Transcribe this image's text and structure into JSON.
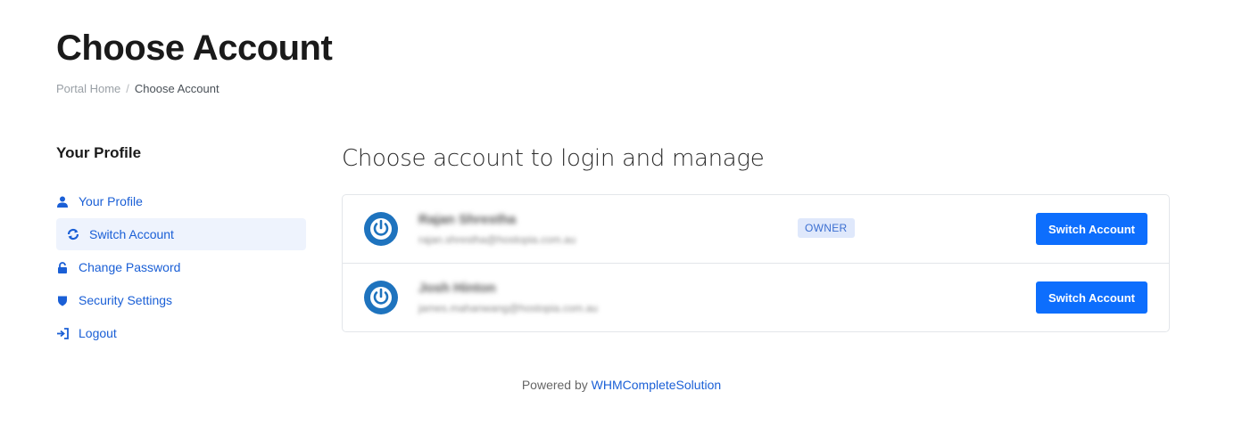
{
  "header": {
    "title": "Choose Account",
    "breadcrumb": [
      {
        "label": "Portal Home"
      },
      {
        "label": "Choose Account"
      }
    ]
  },
  "sidebar": {
    "title": "Your Profile",
    "items": [
      {
        "label": "Your Profile",
        "icon": "user-icon",
        "active": false
      },
      {
        "label": "Switch Account",
        "icon": "refresh-icon",
        "active": true
      },
      {
        "label": "Change Password",
        "icon": "lock-icon",
        "active": false
      },
      {
        "label": "Security Settings",
        "icon": "shield-icon",
        "active": false
      },
      {
        "label": "Logout",
        "icon": "logout-icon",
        "active": false
      }
    ]
  },
  "main": {
    "heading": "Choose account to login and manage",
    "accounts": [
      {
        "name": "Rajan Shrestha",
        "email": "rajan.shrestha@hostopia.com.au",
        "badge": "OWNER",
        "button": "Switch Account"
      },
      {
        "name": "Josh Hinton",
        "email": "james.mahanwang@hostopia.com.au",
        "badge": "",
        "button": "Switch Account"
      }
    ]
  },
  "footer": {
    "prefix": "Powered by",
    "link": "WHMCompleteSolution"
  },
  "colors": {
    "accent": "#0d6efd",
    "link": "#1a5fd6",
    "avatar": "#1e73be",
    "badge_bg": "#dfe8fb"
  }
}
